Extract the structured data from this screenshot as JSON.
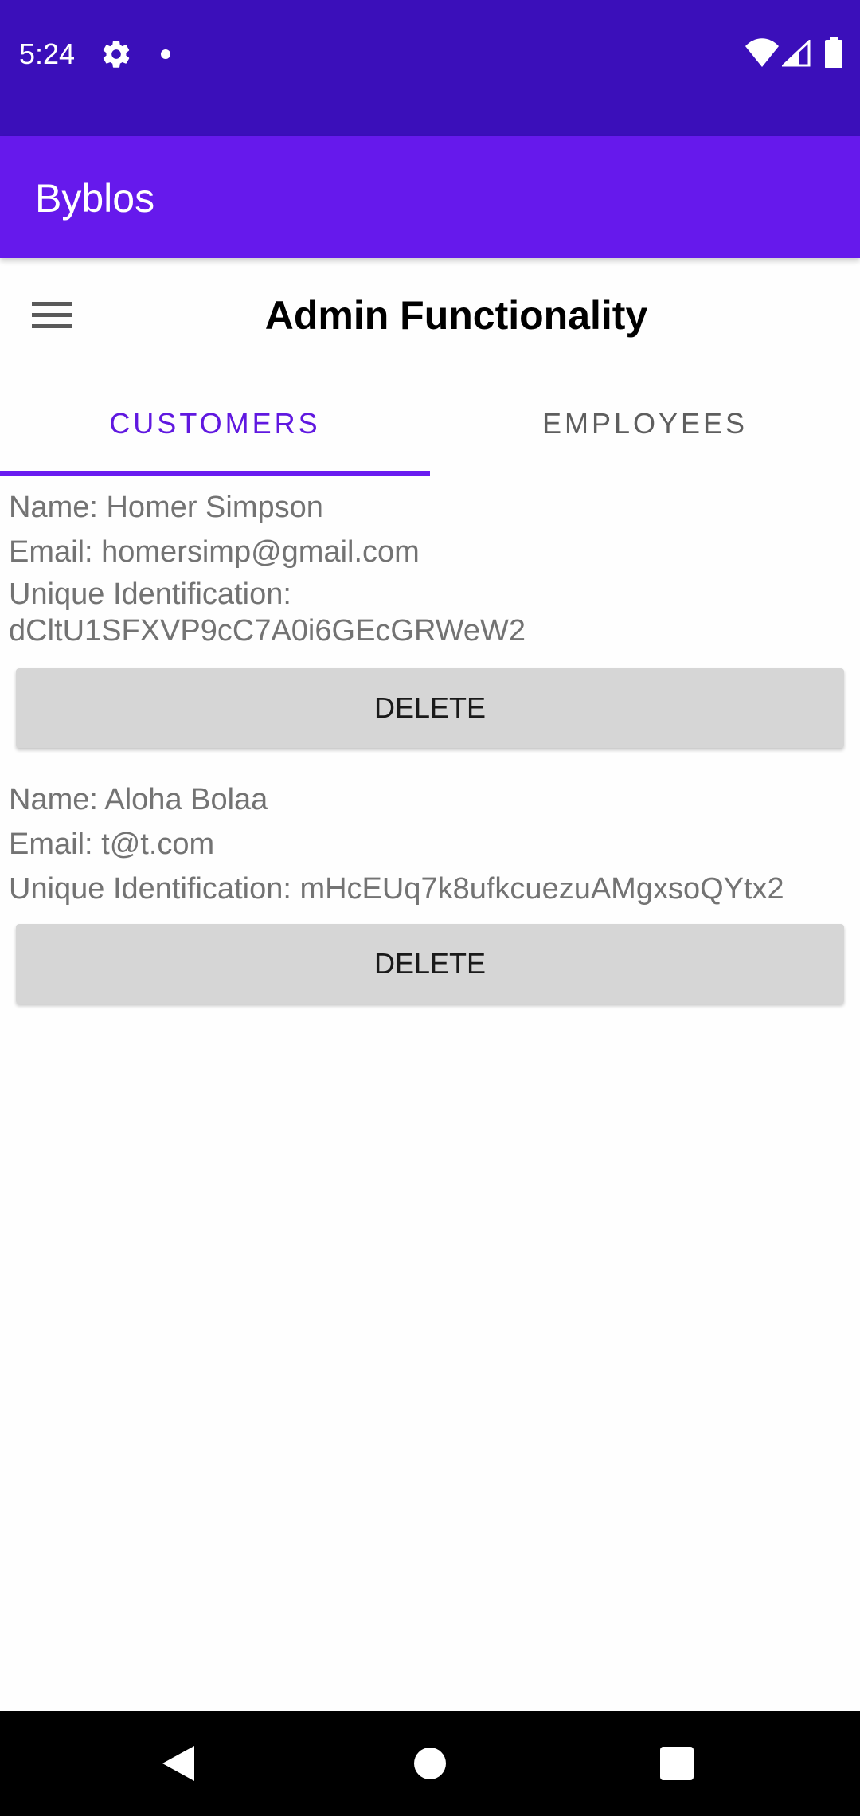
{
  "status_bar": {
    "time": "5:24",
    "icons": [
      "gear-icon",
      "notification-dot-icon",
      "wifi-icon",
      "signal-icon",
      "battery-icon"
    ]
  },
  "app_bar": {
    "title": "Byblos"
  },
  "header": {
    "menu_icon": "hamburger-menu-icon",
    "title": "Admin Functionality"
  },
  "tabs": [
    {
      "label": "CUSTOMERS",
      "selected": true
    },
    {
      "label": "EMPLOYEES",
      "selected": false
    }
  ],
  "customers": [
    {
      "name": "Name: Homer Simpson",
      "email": "Email: homersimp@gmail.com",
      "id_label": "Unique Identification:",
      "id_value": "dCltU1SFXVP9cC7A0i6GEcGRWeW2",
      "delete_label": "DELETE"
    },
    {
      "name": "Name: Aloha Bolaa",
      "email": "Email: t@t.com",
      "id_full": "Unique Identification: mHcEUq7k8ufkcuezuAMgxsoQYtx2",
      "delete_label": "DELETE"
    }
  ],
  "nav_bar": {
    "icons": [
      "back-icon",
      "home-icon",
      "recents-icon"
    ]
  },
  "colors": {
    "status_bar": "#3b0fba",
    "app_bar": "#6619ec",
    "tab_selected": "#6018e0",
    "tab_unselected": "#5e5e5e",
    "button_bg": "#d6d6d6",
    "text_secondary": "#737373"
  }
}
